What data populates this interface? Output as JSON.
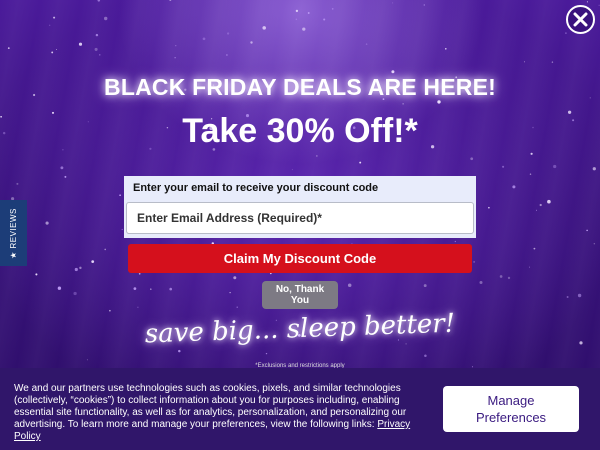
{
  "popup": {
    "headline": "BLACK FRIDAY DEALS ARE HERE!",
    "offer": "Take 30% Off!*",
    "email_label": "Enter your email to receive your discount code",
    "email_placeholder": "Enter Email Address (Required)*",
    "claim_label": "Claim My Discount Code",
    "no_thanks_label": "No, Thank You",
    "tagline": "save big... sleep better!",
    "disclaimer": "*Exclusions and restrictions apply"
  },
  "reviews_tab": {
    "label": "★ REVIEWS"
  },
  "cookie_banner": {
    "text": "We and our partners use technologies such as cookies, pixels, and similar technologies (collectively, “cookies”) to collect information about you for purposes including, enabling essential site functionality, as well as for analytics, personalization, and personalizing our advertising. To learn more and manage your preferences, view the following links: ",
    "link_label": "Privacy Policy",
    "manage_label": "Manage Preferences"
  },
  "colors": {
    "background": "#3a137e",
    "claim_button": "#d5101c",
    "no_thanks_button": "#7d7a84",
    "reviews_tab": "#1c3d78",
    "cookie_bar": "#30166a"
  },
  "icons": {
    "close": "close-icon",
    "star": "star-icon"
  }
}
